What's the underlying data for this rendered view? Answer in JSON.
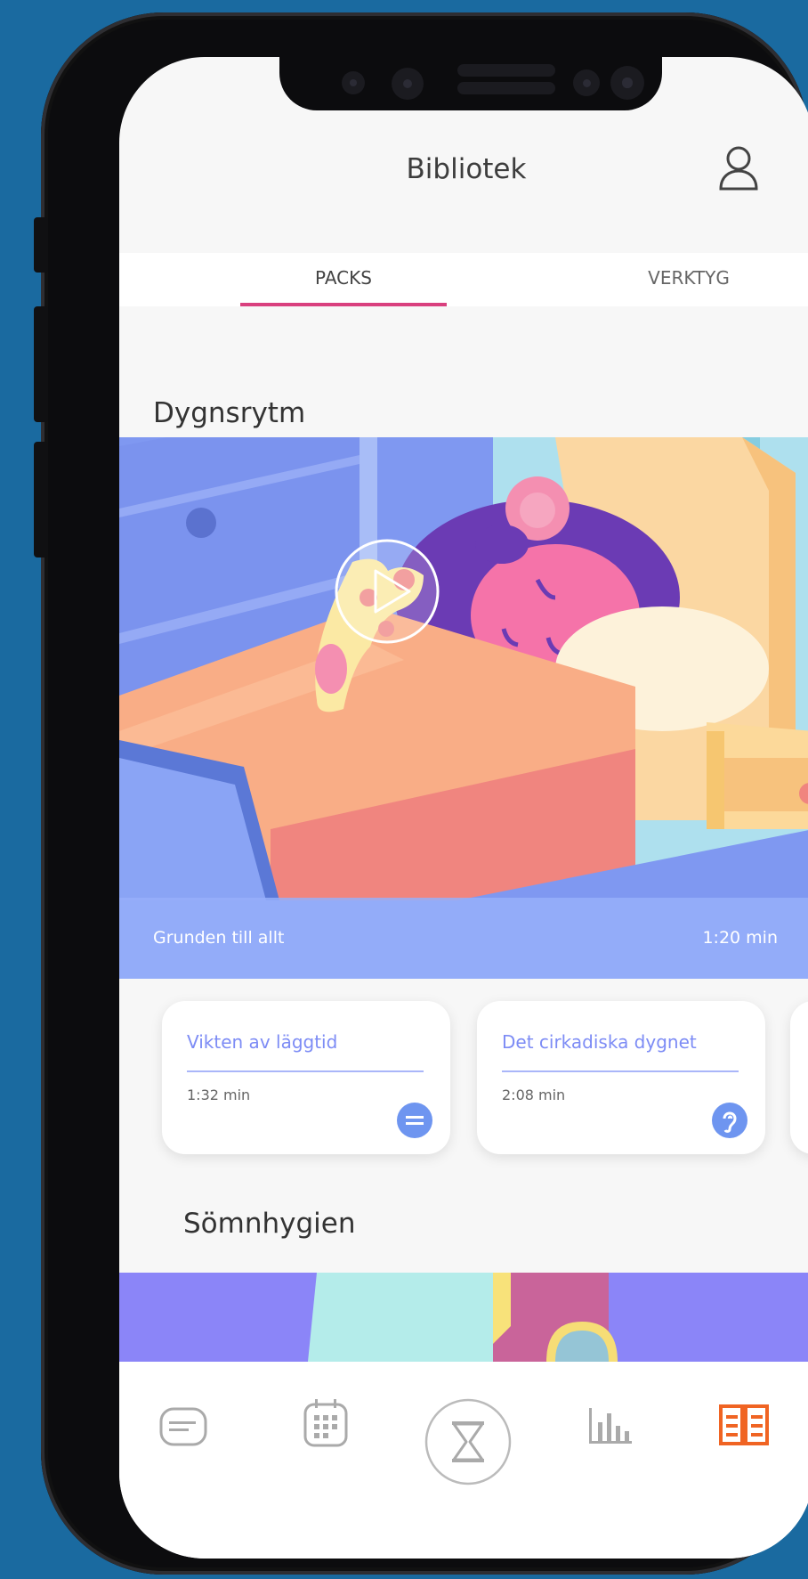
{
  "header": {
    "title": "Bibliotek",
    "profile_icon": "user-icon"
  },
  "tabs": [
    {
      "label": "PACKS",
      "active": true
    },
    {
      "label": "VERKTYG",
      "active": false
    }
  ],
  "sections": [
    {
      "title": "Dygnsrytm",
      "hero": {
        "label": "Grunden till allt",
        "duration": "1:20 min",
        "icon": "play-icon"
      },
      "cards": [
        {
          "title": "Vikten av läggtid",
          "duration": "1:32 min",
          "icon": "text-icon"
        },
        {
          "title": "Det cirkadiska dygnet",
          "duration": "2:08 min",
          "icon": "ear-icon"
        }
      ]
    },
    {
      "title": "Sömnhygien"
    }
  ],
  "nav": [
    {
      "name": "chat-icon",
      "active": false
    },
    {
      "name": "calendar-icon",
      "active": false
    },
    {
      "name": "hourglass-icon",
      "active": false
    },
    {
      "name": "stats-icon",
      "active": false
    },
    {
      "name": "library-icon",
      "active": true
    }
  ],
  "colors": {
    "accent": "#d9407e",
    "active_nav": "#f06423",
    "card_title": "#7d8cf5",
    "background": "#1a6aa0"
  }
}
